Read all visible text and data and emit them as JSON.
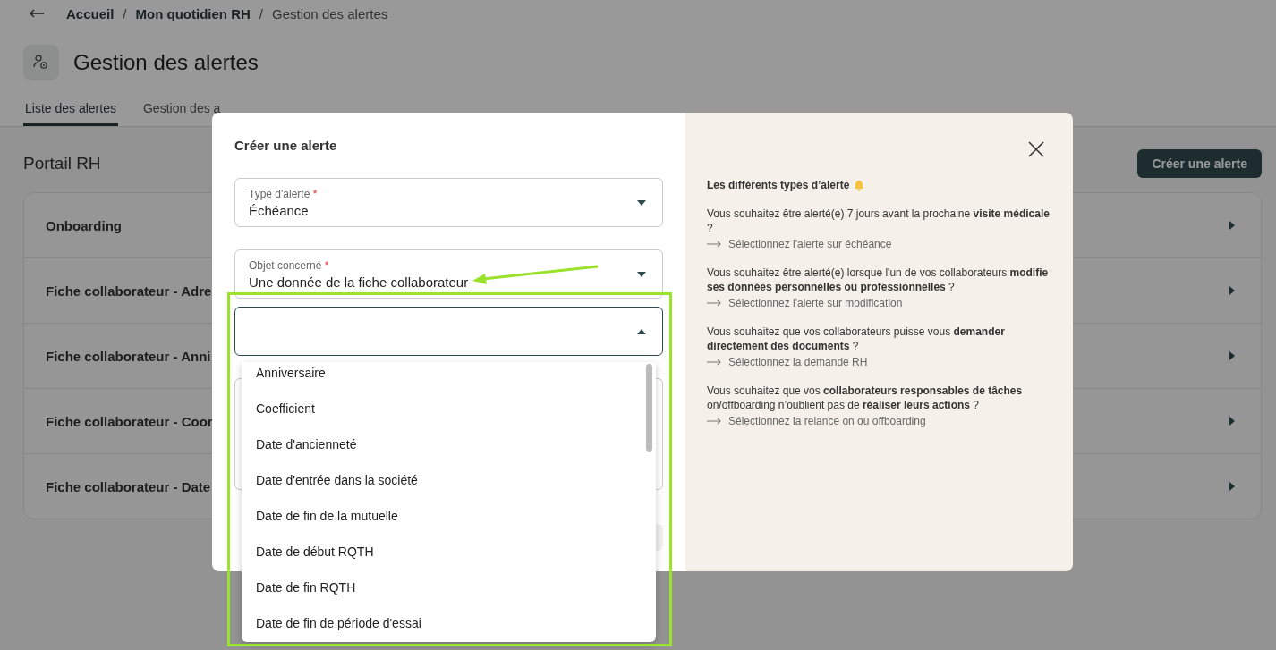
{
  "breadcrumb": [
    {
      "label": "Accueil"
    },
    {
      "label": "Mon quotidien RH",
      "separator": "/"
    },
    {
      "label": "Gestion des alertes",
      "separator": "/"
    }
  ],
  "header": {
    "title": "Gestion des alertes"
  },
  "tabs": [
    {
      "label": "Liste des alertes",
      "selected": true
    },
    {
      "label": "Gestion des a",
      "selected": false
    }
  ],
  "section": {
    "title": "Portail RH",
    "create_button": "Créer une alerte"
  },
  "alert_rows": [
    {
      "label": "Onboarding"
    },
    {
      "label": "Fiche collaborateur - Adre"
    },
    {
      "label": "Fiche collaborateur - Anni"
    },
    {
      "label": "Fiche collaborateur - Coor"
    },
    {
      "label": "Fiche collaborateur - Date"
    }
  ],
  "modal": {
    "title": "Créer une alerte",
    "fields": [
      {
        "label": "Type d'alerte",
        "required_mark": "*",
        "value": "Échéance",
        "expanded": false
      },
      {
        "label": "Objet concerné",
        "required_mark": "*",
        "value": "Une donnée de la fiche collaborateur",
        "expanded": false
      },
      {
        "expanded": true
      }
    ],
    "options": [
      {
        "label": "Anniversaire"
      },
      {
        "label": "Coefficient"
      },
      {
        "label": "Date d'ancienneté"
      },
      {
        "label": "Date d'entrée dans la société"
      },
      {
        "label": "Date de fin de la mutuelle"
      },
      {
        "label": "Date de début RQTH"
      },
      {
        "label": "Date de fin RQTH"
      },
      {
        "label": "Date de fin de période d'essai"
      }
    ],
    "help": {
      "title": "Les différents types d’alerte",
      "items": [
        {
          "question": "Vous souhaitez être alerté(e) 7 jours avant la prochaine **visite médicale** ?",
          "action": "Sélectionnez l'alerte sur échéance"
        },
        {
          "question": "Vous souhaitez être alerté(e) lorsque l'un de vos collaborateurs **modifie ses données personnelles ou professionnelles** ?",
          "action": "Sélectionnez l'alerte sur modification"
        },
        {
          "question": "Vous souhaitez que vos collaborateurs puisse vous **demander directement des documents** ?",
          "action": "Sélectionnez la demande RH"
        },
        {
          "question": "Vous souhaitez que vos **collaborateurs responsables de tâches** on/offboarding n’oublient pas de **réaliser leurs actions** ?",
          "action": "Sélectionnez la relance on ou offboarding"
        }
      ]
    }
  }
}
